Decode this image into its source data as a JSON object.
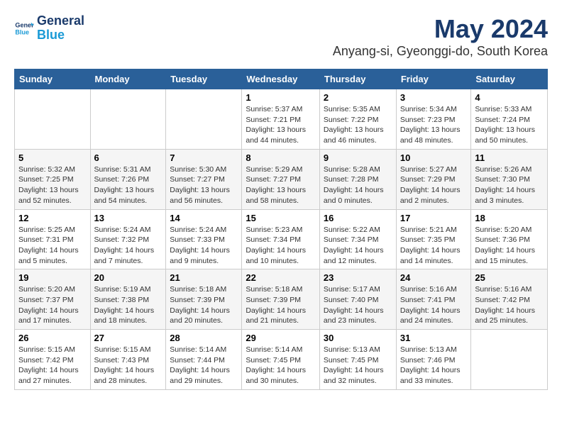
{
  "header": {
    "logo_line1": "General",
    "logo_line2": "Blue",
    "month_title": "May 2024",
    "location": "Anyang-si, Gyeonggi-do, South Korea"
  },
  "weekdays": [
    "Sunday",
    "Monday",
    "Tuesday",
    "Wednesday",
    "Thursday",
    "Friday",
    "Saturday"
  ],
  "weeks": [
    [
      {
        "day": "",
        "sunrise": "",
        "sunset": "",
        "daylight": ""
      },
      {
        "day": "",
        "sunrise": "",
        "sunset": "",
        "daylight": ""
      },
      {
        "day": "",
        "sunrise": "",
        "sunset": "",
        "daylight": ""
      },
      {
        "day": "1",
        "sunrise": "Sunrise: 5:37 AM",
        "sunset": "Sunset: 7:21 PM",
        "daylight": "Daylight: 13 hours and 44 minutes."
      },
      {
        "day": "2",
        "sunrise": "Sunrise: 5:35 AM",
        "sunset": "Sunset: 7:22 PM",
        "daylight": "Daylight: 13 hours and 46 minutes."
      },
      {
        "day": "3",
        "sunrise": "Sunrise: 5:34 AM",
        "sunset": "Sunset: 7:23 PM",
        "daylight": "Daylight: 13 hours and 48 minutes."
      },
      {
        "day": "4",
        "sunrise": "Sunrise: 5:33 AM",
        "sunset": "Sunset: 7:24 PM",
        "daylight": "Daylight: 13 hours and 50 minutes."
      }
    ],
    [
      {
        "day": "5",
        "sunrise": "Sunrise: 5:32 AM",
        "sunset": "Sunset: 7:25 PM",
        "daylight": "Daylight: 13 hours and 52 minutes."
      },
      {
        "day": "6",
        "sunrise": "Sunrise: 5:31 AM",
        "sunset": "Sunset: 7:26 PM",
        "daylight": "Daylight: 13 hours and 54 minutes."
      },
      {
        "day": "7",
        "sunrise": "Sunrise: 5:30 AM",
        "sunset": "Sunset: 7:27 PM",
        "daylight": "Daylight: 13 hours and 56 minutes."
      },
      {
        "day": "8",
        "sunrise": "Sunrise: 5:29 AM",
        "sunset": "Sunset: 7:27 PM",
        "daylight": "Daylight: 13 hours and 58 minutes."
      },
      {
        "day": "9",
        "sunrise": "Sunrise: 5:28 AM",
        "sunset": "Sunset: 7:28 PM",
        "daylight": "Daylight: 14 hours and 0 minutes."
      },
      {
        "day": "10",
        "sunrise": "Sunrise: 5:27 AM",
        "sunset": "Sunset: 7:29 PM",
        "daylight": "Daylight: 14 hours and 2 minutes."
      },
      {
        "day": "11",
        "sunrise": "Sunrise: 5:26 AM",
        "sunset": "Sunset: 7:30 PM",
        "daylight": "Daylight: 14 hours and 3 minutes."
      }
    ],
    [
      {
        "day": "12",
        "sunrise": "Sunrise: 5:25 AM",
        "sunset": "Sunset: 7:31 PM",
        "daylight": "Daylight: 14 hours and 5 minutes."
      },
      {
        "day": "13",
        "sunrise": "Sunrise: 5:24 AM",
        "sunset": "Sunset: 7:32 PM",
        "daylight": "Daylight: 14 hours and 7 minutes."
      },
      {
        "day": "14",
        "sunrise": "Sunrise: 5:24 AM",
        "sunset": "Sunset: 7:33 PM",
        "daylight": "Daylight: 14 hours and 9 minutes."
      },
      {
        "day": "15",
        "sunrise": "Sunrise: 5:23 AM",
        "sunset": "Sunset: 7:34 PM",
        "daylight": "Daylight: 14 hours and 10 minutes."
      },
      {
        "day": "16",
        "sunrise": "Sunrise: 5:22 AM",
        "sunset": "Sunset: 7:34 PM",
        "daylight": "Daylight: 14 hours and 12 minutes."
      },
      {
        "day": "17",
        "sunrise": "Sunrise: 5:21 AM",
        "sunset": "Sunset: 7:35 PM",
        "daylight": "Daylight: 14 hours and 14 minutes."
      },
      {
        "day": "18",
        "sunrise": "Sunrise: 5:20 AM",
        "sunset": "Sunset: 7:36 PM",
        "daylight": "Daylight: 14 hours and 15 minutes."
      }
    ],
    [
      {
        "day": "19",
        "sunrise": "Sunrise: 5:20 AM",
        "sunset": "Sunset: 7:37 PM",
        "daylight": "Daylight: 14 hours and 17 minutes."
      },
      {
        "day": "20",
        "sunrise": "Sunrise: 5:19 AM",
        "sunset": "Sunset: 7:38 PM",
        "daylight": "Daylight: 14 hours and 18 minutes."
      },
      {
        "day": "21",
        "sunrise": "Sunrise: 5:18 AM",
        "sunset": "Sunset: 7:39 PM",
        "daylight": "Daylight: 14 hours and 20 minutes."
      },
      {
        "day": "22",
        "sunrise": "Sunrise: 5:18 AM",
        "sunset": "Sunset: 7:39 PM",
        "daylight": "Daylight: 14 hours and 21 minutes."
      },
      {
        "day": "23",
        "sunrise": "Sunrise: 5:17 AM",
        "sunset": "Sunset: 7:40 PM",
        "daylight": "Daylight: 14 hours and 23 minutes."
      },
      {
        "day": "24",
        "sunrise": "Sunrise: 5:16 AM",
        "sunset": "Sunset: 7:41 PM",
        "daylight": "Daylight: 14 hours and 24 minutes."
      },
      {
        "day": "25",
        "sunrise": "Sunrise: 5:16 AM",
        "sunset": "Sunset: 7:42 PM",
        "daylight": "Daylight: 14 hours and 25 minutes."
      }
    ],
    [
      {
        "day": "26",
        "sunrise": "Sunrise: 5:15 AM",
        "sunset": "Sunset: 7:42 PM",
        "daylight": "Daylight: 14 hours and 27 minutes."
      },
      {
        "day": "27",
        "sunrise": "Sunrise: 5:15 AM",
        "sunset": "Sunset: 7:43 PM",
        "daylight": "Daylight: 14 hours and 28 minutes."
      },
      {
        "day": "28",
        "sunrise": "Sunrise: 5:14 AM",
        "sunset": "Sunset: 7:44 PM",
        "daylight": "Daylight: 14 hours and 29 minutes."
      },
      {
        "day": "29",
        "sunrise": "Sunrise: 5:14 AM",
        "sunset": "Sunset: 7:45 PM",
        "daylight": "Daylight: 14 hours and 30 minutes."
      },
      {
        "day": "30",
        "sunrise": "Sunrise: 5:13 AM",
        "sunset": "Sunset: 7:45 PM",
        "daylight": "Daylight: 14 hours and 32 minutes."
      },
      {
        "day": "31",
        "sunrise": "Sunrise: 5:13 AM",
        "sunset": "Sunset: 7:46 PM",
        "daylight": "Daylight: 14 hours and 33 minutes."
      },
      {
        "day": "",
        "sunrise": "",
        "sunset": "",
        "daylight": ""
      }
    ]
  ]
}
